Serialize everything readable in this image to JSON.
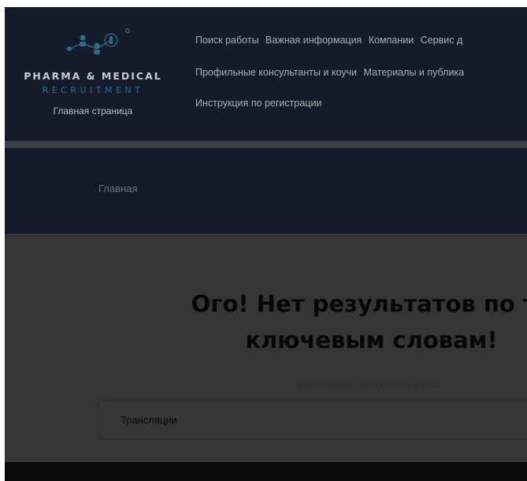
{
  "header": {
    "brand_line1": "PHARMA & MEDICAL",
    "brand_line2": "RECRUITMENT",
    "home_link": "Главная страница",
    "logo_icon": "people-network-icon",
    "nav": {
      "row1": [
        "Поиск работы",
        "Важная информация",
        "Компании",
        "Сервис д"
      ],
      "row2": [
        "Профильные консультанты и коучи",
        "Материалы и публика"
      ],
      "row3": [
        "Инструкция по регистрации"
      ]
    }
  },
  "breadcrumb": {
    "home": "Главная"
  },
  "main": {
    "heading_line1": "Ого! Нет результатов по та",
    "heading_line2": "ключевым словам!",
    "hint": "Пожалуйста, попробуйте снова.",
    "search_value": "Трансляции"
  }
}
